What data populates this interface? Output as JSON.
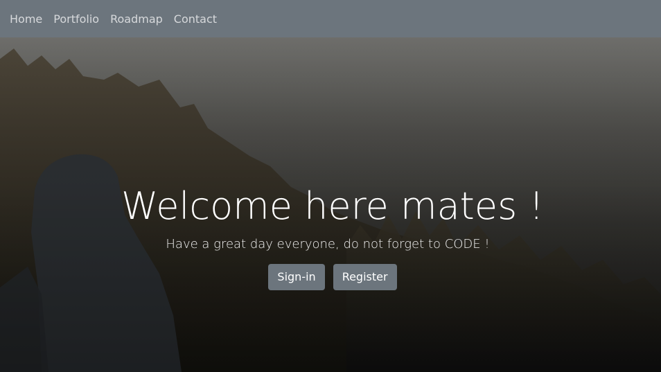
{
  "nav": {
    "items": [
      {
        "label": "Home"
      },
      {
        "label": "Portfolio"
      },
      {
        "label": "Roadmap"
      },
      {
        "label": "Contact"
      }
    ]
  },
  "hero": {
    "title": "Welcome here mates !",
    "subtitle": "Have a great day everyone, do not forget to CODE !",
    "buttons": {
      "signin_label": "Sign-in",
      "register_label": "Register"
    }
  },
  "colors": {
    "navbar": "#6c757d",
    "button": "#6c757d",
    "text": "#ffffff"
  }
}
